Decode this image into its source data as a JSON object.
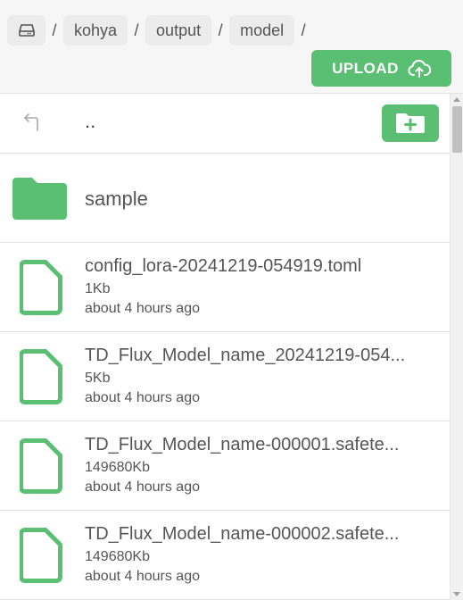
{
  "breadcrumb": {
    "home_icon": "drive-icon",
    "items": [
      "kohya",
      "output",
      "model"
    ],
    "separator": "/"
  },
  "upload": {
    "label": "UPLOAD",
    "icon": "cloud-upload-icon"
  },
  "parent_dir": {
    "label": "..",
    "icon": "return-up-icon",
    "new_folder_icon": "folder-plus-icon"
  },
  "folders": [
    {
      "name": "sample",
      "icon": "folder-icon"
    }
  ],
  "files": [
    {
      "name": "config_lora-20241219-054919.toml",
      "size": "1Kb",
      "modified": "about 4 hours ago"
    },
    {
      "name": "TD_Flux_Model_name_20241219-054...",
      "size": "5Kb",
      "modified": "about 4 hours ago"
    },
    {
      "name": "TD_Flux_Model_name-000001.safete...",
      "size": "149680Kb",
      "modified": "about 4 hours ago"
    },
    {
      "name": "TD_Flux_Model_name-000002.safete...",
      "size": "149680Kb",
      "modified": "about 4 hours ago"
    }
  ],
  "colors": {
    "accent": "#5bbf73",
    "header_bg": "#f6f6f6",
    "crumb_bg": "#ececec",
    "divider": "#e3e3e3"
  }
}
